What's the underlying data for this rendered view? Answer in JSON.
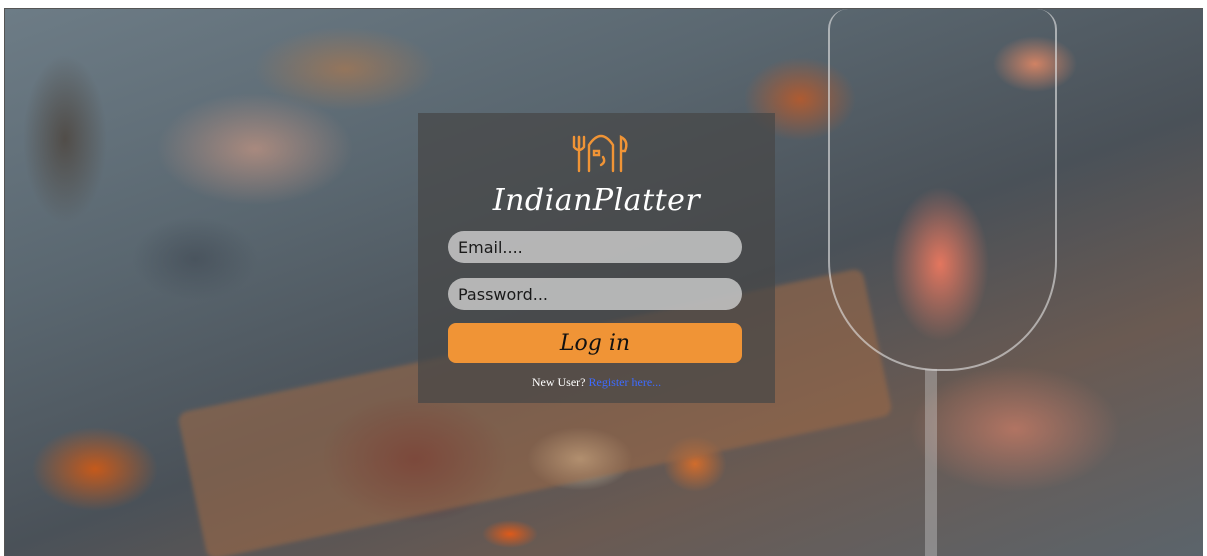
{
  "brand": {
    "name": "IndianPlatter",
    "logo_icon": "plate-cutlery-icon"
  },
  "login_form": {
    "email_placeholder": "Email....",
    "password_placeholder": "Password...",
    "login_label": "Log in",
    "new_user_text": "New User?",
    "register_link": "Register here..."
  },
  "colors": {
    "accent": "#f09436",
    "link": "#3d6bff",
    "overlay": "#464646"
  }
}
